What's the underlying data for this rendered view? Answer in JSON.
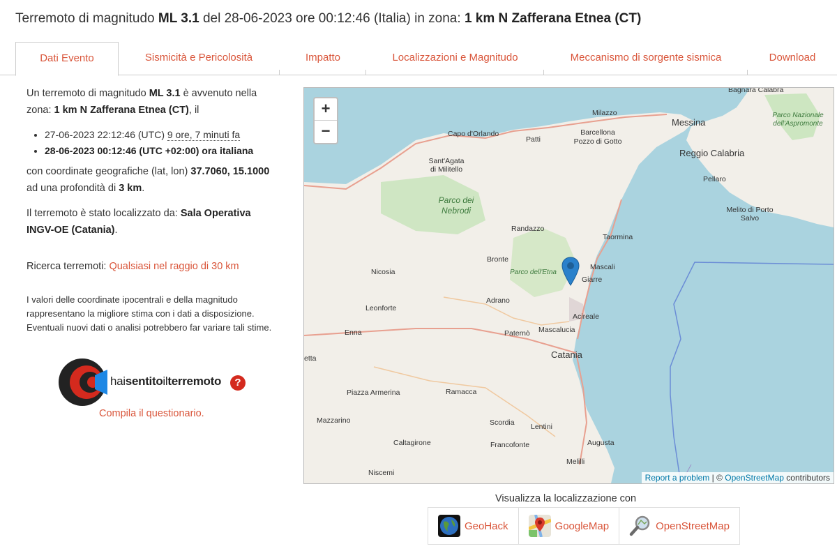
{
  "header": {
    "t1": "Terremoto di magnitudo ",
    "mag": "ML 3.1",
    "t2": " del 28-06-2023 ore 00:12:46 (Italia) in zona: ",
    "zone": "1 km N Zafferana Etnea (CT)"
  },
  "tabs": [
    {
      "label": "Dati Evento"
    },
    {
      "label": "Sismicità e Pericolosità"
    },
    {
      "label": "Impatto"
    },
    {
      "label": "Localizzazioni e Magnitudo"
    },
    {
      "label": "Meccanismo di sorgente sismica"
    },
    {
      "label": "Download"
    }
  ],
  "left": {
    "intro1": "Un terremoto di magnitudo ",
    "mag": "ML 3.1",
    "intro2": " è avvenuto nella zona: ",
    "zone": "1 km N Zafferana Etnea (CT)",
    "intro3": ", il",
    "utc_time": "27-06-2023 22:12:46 (UTC) ",
    "utc_ago": "9 ore, 7 minuti fa",
    "local_time": "28-06-2023 00:12:46 (UTC +02:00) ora italiana",
    "coord1": "con coordinate geografiche (lat, lon) ",
    "coords": "37.7060, 15.1000",
    "coord2": " ad una profondità di ",
    "depth": "3 km",
    "coord3": ".",
    "loc1": "Il terremoto è stato localizzato da: ",
    "loc_by": "Sala Operativa INGV-OE (Catania)",
    "loc2": ".",
    "search_label": "Ricerca terremoti: ",
    "search_link": "Qualsiasi nel raggio di 30 km",
    "note": "I valori delle coordinate ipocentrali e della magnitudo rappresentano la migliore stima con i dati a disposizione. Eventuali nuovi dati o analisi potrebbero far variare tali stime.",
    "hst_hai": "hai",
    "hst_sentito": "sentito",
    "hst_il": "il",
    "hst_terremoto": "terremoto",
    "hst_q": "?",
    "compila": "Compila il questionario."
  },
  "map": {
    "zoom_in": "+",
    "zoom_out": "−",
    "attrib_report": "Report a problem",
    "attrib_sep": " | © ",
    "attrib_osm": "OpenStreetMap",
    "attrib_contrib": " contributors",
    "labels": {
      "bagnara": "Bagnara Calabra",
      "milazzo": "Milazzo",
      "messina": "Messina",
      "aspromonte": "Parco Nazionale dell'Aspromonte",
      "capo": "Capo d'Orlando",
      "patti": "Patti",
      "barcellona": "Barcellona Pozzo di Gotto",
      "reggio": "Reggio Calabria",
      "santagata": "Sant'Agata di Militello",
      "pellaro": "Pellaro",
      "nebrodi": "Parco dei Nebrodi",
      "melito": "Melito di Porto Salvo",
      "randazzo": "Randazzo",
      "taormina": "Taormina",
      "bronte": "Bronte",
      "etna": "Parco dell'Etna",
      "mascali": "Mascali",
      "giarre": "Giarre",
      "nicosia": "Nicosia",
      "adrano": "Adrano",
      "leonforte": "Leonforte",
      "acireale": "Acireale",
      "enna": "Enna",
      "paterno": "Paternò",
      "mascalucia": "Mascalucia",
      "etta": "etta",
      "catania": "Catania",
      "piazza": "Piazza Armerina",
      "ramacca": "Ramacca",
      "mazzarino": "Mazzarino",
      "scordia": "Scordia",
      "lentini": "Lentini",
      "caltagirone": "Caltagirone",
      "francofonte": "Francofonte",
      "augusta": "Augusta",
      "melilli": "Melilli",
      "niscemi": "Niscemi"
    }
  },
  "visualizza": {
    "title": "Visualizza la localizzazione con",
    "buttons": [
      {
        "label": "GeoHack"
      },
      {
        "label": "GoogleMap"
      },
      {
        "label": "OpenStreetMap"
      }
    ]
  }
}
